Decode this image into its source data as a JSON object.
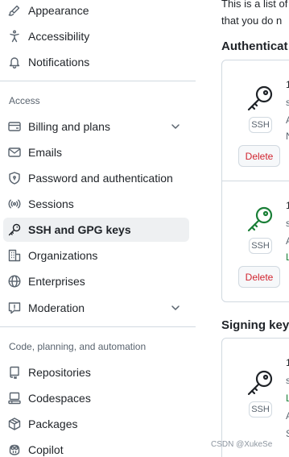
{
  "sidebar": {
    "items_top": [
      {
        "label": "Appearance",
        "icon": "paintbrush-icon"
      },
      {
        "label": "Accessibility",
        "icon": "accessibility-icon"
      },
      {
        "label": "Notifications",
        "icon": "bell-icon"
      }
    ],
    "access_heading": "Access",
    "access_items": [
      {
        "label": "Billing and plans",
        "icon": "credit-card-icon",
        "expandable": true
      },
      {
        "label": "Emails",
        "icon": "mail-icon"
      },
      {
        "label": "Password and authentication",
        "icon": "shield-lock-icon"
      },
      {
        "label": "Sessions",
        "icon": "broadcast-icon"
      },
      {
        "label": "SSH and GPG keys",
        "icon": "key-icon",
        "active": true
      },
      {
        "label": "Organizations",
        "icon": "organization-icon"
      },
      {
        "label": "Enterprises",
        "icon": "globe-icon"
      },
      {
        "label": "Moderation",
        "icon": "report-icon",
        "expandable": true
      }
    ],
    "code_heading": "Code, planning, and automation",
    "code_items": [
      {
        "label": "Repositories",
        "icon": "repo-icon"
      },
      {
        "label": "Codespaces",
        "icon": "codespaces-icon"
      },
      {
        "label": "Packages",
        "icon": "package-icon"
      },
      {
        "label": "Copilot",
        "icon": "copilot-icon"
      }
    ]
  },
  "main": {
    "intro_line1": "This is a list of",
    "intro_line2": "that you do n",
    "auth_title": "Authenticat",
    "signing_title": "Signing key",
    "auth_keys": [
      {
        "badge": "SSH",
        "delete_label": "Delete",
        "icon_color": "#1f2328",
        "frags": [
          "1",
          "s",
          "A",
          "N"
        ]
      },
      {
        "badge": "SSH",
        "delete_label": "Delete",
        "icon_color": "#1a7f37",
        "frags": [
          "1",
          "s",
          "A",
          "L"
        ]
      }
    ],
    "signing_keys": [
      {
        "badge": "SSH",
        "icon_color": "#1f2328",
        "frags": [
          "1",
          "s",
          "L",
          "A",
          "S"
        ]
      }
    ]
  },
  "watermark": "CSDN @XukeSe",
  "colors": {
    "active_bg": "#eef0f2",
    "border": "#d1d9e0",
    "danger": "#d1242f",
    "success": "#1a7f37",
    "muted": "#59636e"
  }
}
